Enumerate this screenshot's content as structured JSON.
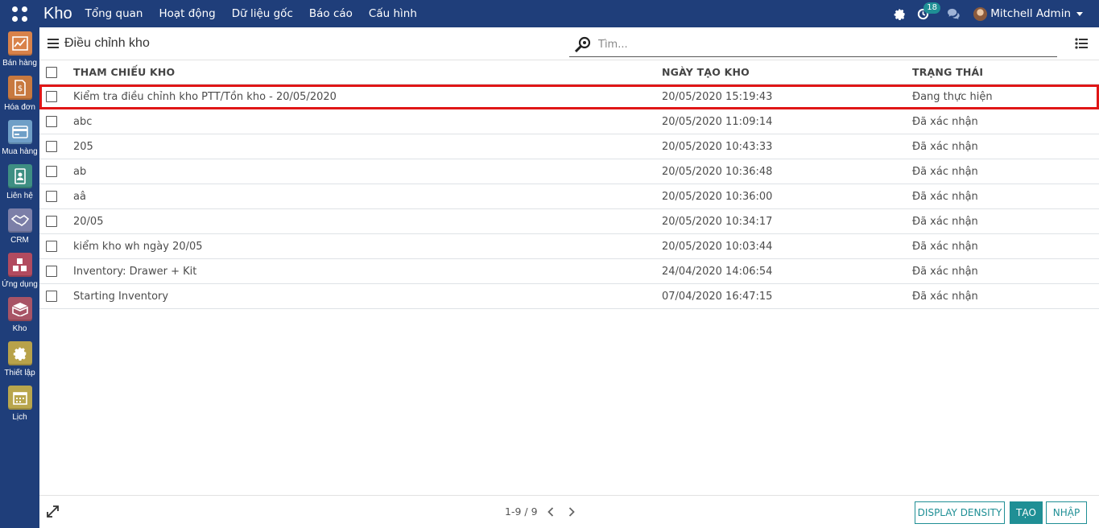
{
  "navbar": {
    "app_name": "Kho",
    "menu": [
      "Tổng quan",
      "Hoạt động",
      "Dữ liệu gốc",
      "Báo cáo",
      "Cấu hình"
    ],
    "activity_count": "18",
    "user_name": "Mitchell Admin"
  },
  "sidebar": {
    "apps": [
      {
        "label": "Bán hàng",
        "color": "#d9824a",
        "icon": "sales-chart-icon"
      },
      {
        "label": "Hóa đơn",
        "color": "#c8793f",
        "icon": "invoice-icon"
      },
      {
        "label": "Mua hàng",
        "color": "#6f9fc7",
        "icon": "purchase-card-icon"
      },
      {
        "label": "Liên hệ",
        "color": "#3e8f83",
        "icon": "contacts-book-icon"
      },
      {
        "label": "CRM",
        "color": "#7c7fa8",
        "icon": "handshake-icon"
      },
      {
        "label": "Ứng dụng",
        "color": "#b24b5f",
        "icon": "apps-cubes-icon"
      },
      {
        "label": "Kho",
        "color": "#a85466",
        "icon": "inventory-box-icon"
      },
      {
        "label": "Thiết lập",
        "color": "#b8a24a",
        "icon": "settings-gear-icon"
      },
      {
        "label": "Lịch",
        "color": "#b9a64d",
        "icon": "calendar-icon"
      }
    ]
  },
  "control": {
    "title": "Điều chỉnh kho",
    "search_placeholder": "Tìm..."
  },
  "table": {
    "columns": [
      "THAM CHIẾU KHO",
      "NGÀY TẠO KHO",
      "TRẠNG THÁI"
    ],
    "rows": [
      {
        "ref": "Kiểm tra điều chỉnh kho PTT/Tồn kho - 20/05/2020",
        "date": "20/05/2020 15:19:43",
        "state": "Đang thực hiện",
        "highlight": true
      },
      {
        "ref": "abc",
        "date": "20/05/2020 11:09:14",
        "state": "Đã xác nhận"
      },
      {
        "ref": "205",
        "date": "20/05/2020 10:43:33",
        "state": "Đã xác nhận"
      },
      {
        "ref": "ab",
        "date": "20/05/2020 10:36:48",
        "state": "Đã xác nhận"
      },
      {
        "ref": "aâ",
        "date": "20/05/2020 10:36:00",
        "state": "Đã xác nhận"
      },
      {
        "ref": "20/05",
        "date": "20/05/2020 10:34:17",
        "state": "Đã xác nhận"
      },
      {
        "ref": "kiểm kho wh ngày 20/05",
        "date": "20/05/2020 10:03:44",
        "state": "Đã xác nhận"
      },
      {
        "ref": "Inventory: Drawer + Kit",
        "date": "24/04/2020 14:06:54",
        "state": "Đã xác nhận"
      },
      {
        "ref": "Starting Inventory",
        "date": "07/04/2020 16:47:15",
        "state": "Đã xác nhận"
      }
    ]
  },
  "footer": {
    "pager": "1-9 / 9",
    "density_label": "DISPLAY DENSITY",
    "create_label": "TẠO",
    "import_label": "NHẬP"
  },
  "colors": {
    "navbar": "#1f3e7a",
    "accent": "#1f8f95",
    "highlight_border": "#e01616"
  }
}
